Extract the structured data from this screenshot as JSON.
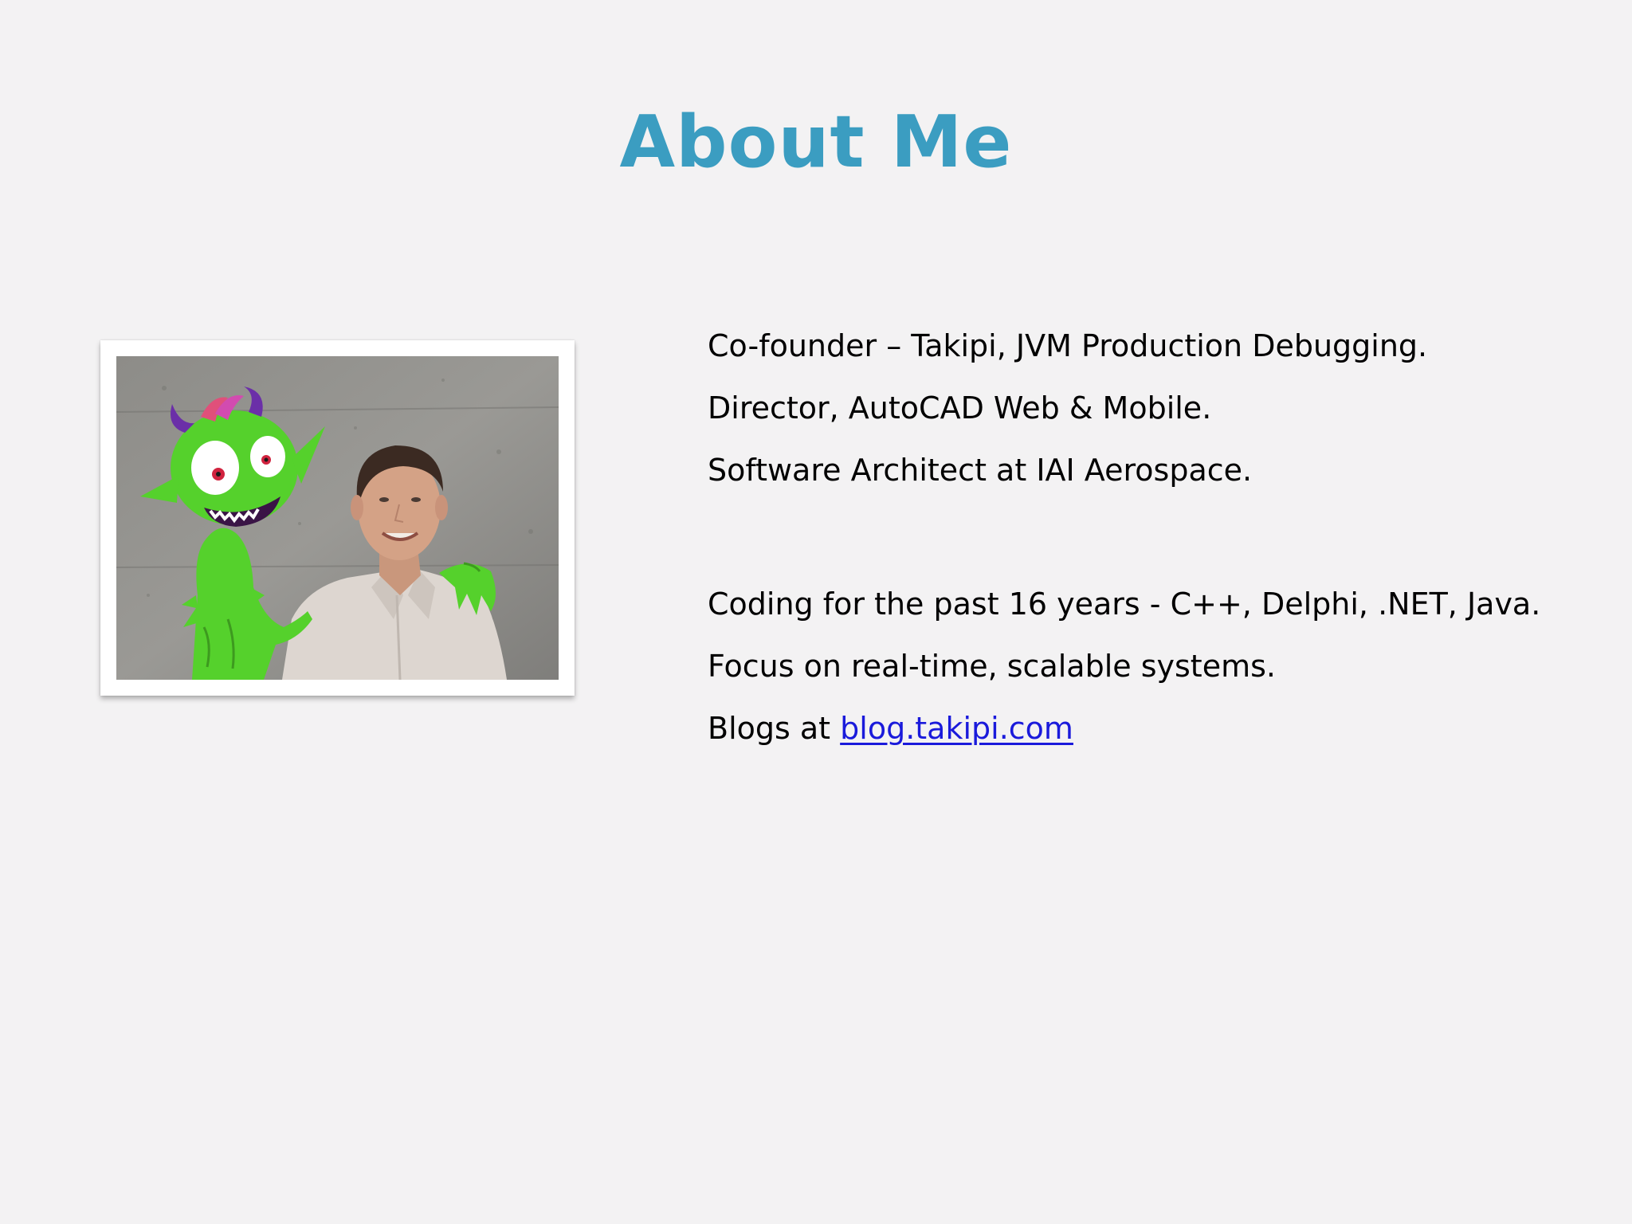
{
  "slide": {
    "title": "About Me",
    "lines_group1": [
      "Co-founder – Takipi, JVM Production Debugging.",
      "Director, AutoCAD Web & Mobile.",
      "Software Architect at IAI Aerospace."
    ],
    "lines_group2": [
      "Coding for the past 16 years - C++, Delphi, .NET, Java.",
      "Focus on real-time, scalable systems."
    ],
    "blog_prefix": "Blogs at",
    "blog_link": "blog.takipi.com"
  },
  "colors": {
    "background": "#f3f2f3",
    "title": "#3b9dc1",
    "text": "#000000",
    "link": "#1a1adb",
    "monster_green": "#55d12c"
  },
  "photo": {
    "subject": "portrait-with-green-monster-mascot"
  }
}
